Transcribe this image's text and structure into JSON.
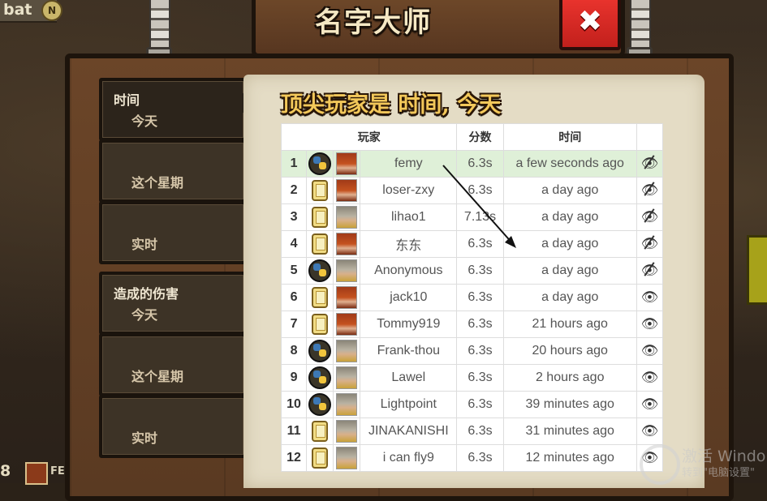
{
  "hud": {
    "top_label": "bat",
    "coin_label": "N",
    "bottom_number": "8",
    "bottom_text": "FE"
  },
  "dialog": {
    "title": "名字大师",
    "close_symbol": "✖"
  },
  "sidebar": {
    "groups": [
      {
        "category": "时间",
        "items": [
          {
            "label": "今天",
            "active": true
          },
          {
            "label": "这个星期",
            "active": false
          },
          {
            "label": "实时",
            "active": false
          }
        ]
      },
      {
        "category": "造成的伤害",
        "items": [
          {
            "label": "今天",
            "active": false
          },
          {
            "label": "这个星期",
            "active": false
          },
          {
            "label": "实时",
            "active": false
          }
        ]
      }
    ]
  },
  "leaderboard": {
    "heading": "顶尖玩家是 时间, 今天",
    "columns": {
      "player": "玩家",
      "score": "分数",
      "time": "时间"
    },
    "rows": [
      {
        "rank": "1",
        "lang": "python",
        "hero": "red",
        "name": "femy",
        "score": "6.3s",
        "time": "a few seconds ago",
        "watch": "hidden",
        "me": true
      },
      {
        "rank": "2",
        "lang": "javascript",
        "hero": "red",
        "name": "loser-zxy",
        "score": "6.3s",
        "time": "a day ago",
        "watch": "hidden",
        "me": false
      },
      {
        "rank": "3",
        "lang": "javascript",
        "hero": "gray",
        "name": "lihao1",
        "score": "7.13s",
        "time": "a day ago",
        "watch": "hidden",
        "me": false
      },
      {
        "rank": "4",
        "lang": "javascript",
        "hero": "red",
        "name": "东东",
        "score": "6.3s",
        "time": "a day ago",
        "watch": "hidden",
        "me": false
      },
      {
        "rank": "5",
        "lang": "python",
        "hero": "gray",
        "name": "Anonymous",
        "score": "6.3s",
        "time": "a day ago",
        "watch": "hidden",
        "me": false
      },
      {
        "rank": "6",
        "lang": "javascript",
        "hero": "red",
        "name": "jack10",
        "score": "6.3s",
        "time": "a day ago",
        "watch": "eye",
        "me": false
      },
      {
        "rank": "7",
        "lang": "javascript",
        "hero": "red",
        "name": "Tommy919",
        "score": "6.3s",
        "time": "21 hours ago",
        "watch": "eye",
        "me": false
      },
      {
        "rank": "8",
        "lang": "python",
        "hero": "gray",
        "name": "Frank-thou",
        "score": "6.3s",
        "time": "20 hours ago",
        "watch": "eye",
        "me": false
      },
      {
        "rank": "9",
        "lang": "python",
        "hero": "gray",
        "name": "Lawel",
        "score": "6.3s",
        "time": "2 hours ago",
        "watch": "eye",
        "me": false
      },
      {
        "rank": "10",
        "lang": "python",
        "hero": "gray",
        "name": "Lightpoint",
        "score": "6.3s",
        "time": "39 minutes ago",
        "watch": "eye",
        "me": false
      },
      {
        "rank": "11",
        "lang": "javascript",
        "hero": "gray",
        "name": "JINAKANISHI",
        "score": "6.3s",
        "time": "31 minutes ago",
        "watch": "eye",
        "me": false
      },
      {
        "rank": "12",
        "lang": "javascript",
        "hero": "gray",
        "name": "i can fly9",
        "score": "6.3s",
        "time": "12 minutes ago",
        "watch": "eye",
        "me": false
      }
    ]
  },
  "watermark": {
    "line1": "激活 Windo",
    "line2": "转到\"电脑设置\""
  }
}
